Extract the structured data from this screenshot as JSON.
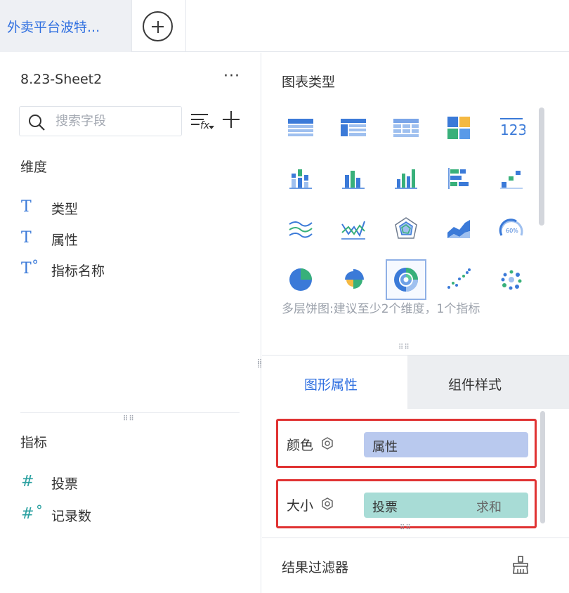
{
  "tabs": {
    "active_label": "外卖平台波特...",
    "add_icon": "plus-circle-icon"
  },
  "left": {
    "sheet_name": "8.23-Sheet2",
    "more_label": "···",
    "search_placeholder": "搜索字段",
    "dimensions_title": "维度",
    "dimensions": [
      {
        "icon": "T",
        "label": "类型"
      },
      {
        "icon": "T",
        "label": "属性"
      },
      {
        "icon": "T˚",
        "label": "指标名称"
      }
    ],
    "measures_title": "指标",
    "measures": [
      {
        "icon": "#",
        "label": "投票"
      },
      {
        "icon": "#˚",
        "label": "记录数"
      }
    ]
  },
  "right": {
    "chart_types_title": "图表类型",
    "chart_icons": [
      "table-icon",
      "cross-table-icon",
      "grid-table-icon",
      "kpi-card-icon",
      "number-123-icon",
      "stacked-bar-icon",
      "grouped-column-icon",
      "column-icon",
      "horizontal-bar-icon",
      "scatter-step-icon",
      "line-icon",
      "multi-line-icon",
      "radar-icon",
      "area-icon",
      "gauge-icon",
      "pie-icon",
      "rose-pie-icon",
      "multi-level-pie-icon",
      "scatter-icon",
      "bubble-icon"
    ],
    "selected_chart": "multi-level-pie-icon",
    "gauge_text": "60%",
    "number_text": "123",
    "hint": "多层饼图:建议至少2个维度，1个指标",
    "tab_shape": "图形属性",
    "tab_style": "组件样式",
    "color_label": "颜色",
    "color_field": "属性",
    "size_label": "大小",
    "size_field": "投票",
    "size_agg": "求和",
    "result_filter": "结果过滤器",
    "accent": "#2f6fe0",
    "highlight": "#e03333"
  }
}
